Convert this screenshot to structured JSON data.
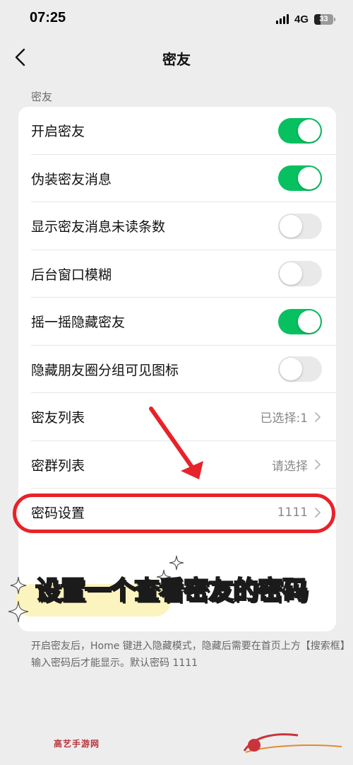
{
  "status_bar": {
    "time": "07:25",
    "network": "4G",
    "battery": "33"
  },
  "nav": {
    "title": "密友"
  },
  "section_label": "密友",
  "rows": [
    {
      "label": "开启密友",
      "type": "toggle",
      "on": true
    },
    {
      "label": "伪装密友消息",
      "type": "toggle",
      "on": true
    },
    {
      "label": "显示密友消息未读条数",
      "type": "toggle",
      "on": false
    },
    {
      "label": "后台窗口模糊",
      "type": "toggle",
      "on": false
    },
    {
      "label": "摇一摇隐藏密友",
      "type": "toggle",
      "on": true
    },
    {
      "label": "隐藏朋友圈分组可见图标",
      "type": "toggle",
      "on": false
    },
    {
      "label": "密友列表",
      "type": "link",
      "value": "已选择:1"
    },
    {
      "label": "密群列表",
      "type": "link",
      "value": "请选择"
    },
    {
      "label": "密码设置",
      "type": "link",
      "value": "1111"
    }
  ],
  "annotation": {
    "caption": "设置一个查看密友的密码"
  },
  "footer_note": "开启密友后，Home 键进入隐藏模式，隐藏后需要在首页上方【搜索框】输入密码后才能显示。默认密码 1111",
  "watermark": {
    "text": "高艺手游网"
  },
  "colors": {
    "toggle_on": "#07c160",
    "toggle_off": "#e9e9ea",
    "highlight_red": "#e8222a",
    "caption_yellow": "#ffe83b"
  }
}
